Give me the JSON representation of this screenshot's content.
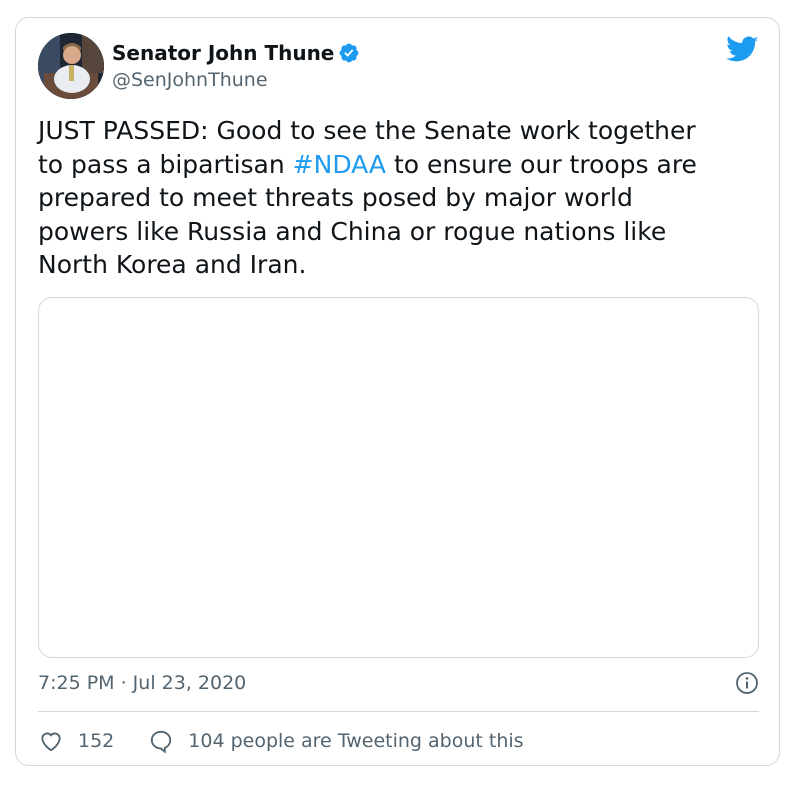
{
  "tweet": {
    "author": {
      "display_name": "Senator John Thune",
      "handle": "@SenJohnThune",
      "verified": true,
      "avatar_icon": "profile-photo"
    },
    "text_before_hashtag": "JUST PASSED: Good to see the Senate work together\nto pass a bipartisan ",
    "hashtag": "#NDAA",
    "text_after_hashtag": " to ensure our troops are\nprepared to meet threats posed by major world\npowers like Russia and China or rogue nations like\nNorth Korea and Iran.",
    "timestamp": "7:25 PM · Jul 23, 2020",
    "likes": "152",
    "discussion": "104 people are Tweeting about this"
  },
  "icons": {
    "brand": "twitter-bird-icon",
    "verified": "verified-badge-icon",
    "info": "info-icon",
    "like": "heart-icon",
    "reply": "reply-bubble-icon"
  },
  "colors": {
    "accent": "#1d9bf0",
    "text": "#0f1419",
    "secondary_text": "#536471",
    "border": "#cfd9de"
  }
}
